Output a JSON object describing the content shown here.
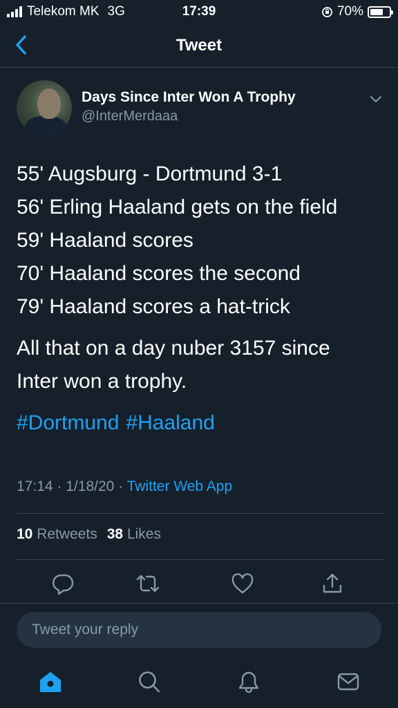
{
  "status_bar": {
    "carrier": "Telekom MK",
    "network": "3G",
    "time": "17:39",
    "battery": "70%",
    "battery_level": 0.7
  },
  "nav": {
    "title": "Tweet",
    "back_icon": "chevron-left-icon"
  },
  "tweet": {
    "display_name": "Days Since Inter Won A Trophy",
    "handle": "@InterMerdaaa",
    "lines": [
      "55' Augsburg - Dortmund 3-1",
      "56' Erling Haaland gets on the field",
      "59' Haaland scores",
      "70' Haaland scores the second",
      "79' Haaland scores a hat-trick"
    ],
    "paragraph2": [
      "All that on a day nuber 3157 since",
      "Inter won a trophy."
    ],
    "hashtags": [
      "#Dortmund",
      "#Haaland"
    ],
    "time": "17:14",
    "separator": "·",
    "date": "1/18/20",
    "source": "Twitter Web App",
    "retweets_count": "10",
    "retweets_label": "Retweets",
    "likes_count": "38",
    "likes_label": "Likes"
  },
  "actions": [
    "reply-icon",
    "retweet-icon",
    "like-icon",
    "share-icon"
  ],
  "reply": {
    "placeholder": "Tweet your reply"
  },
  "tab_bar": [
    "home-icon",
    "search-icon",
    "notifications-icon",
    "messages-icon"
  ],
  "colors": {
    "background": "#15202b",
    "accent": "#1da1f2",
    "secondary_text": "#8899a6",
    "divider": "#38444d"
  }
}
